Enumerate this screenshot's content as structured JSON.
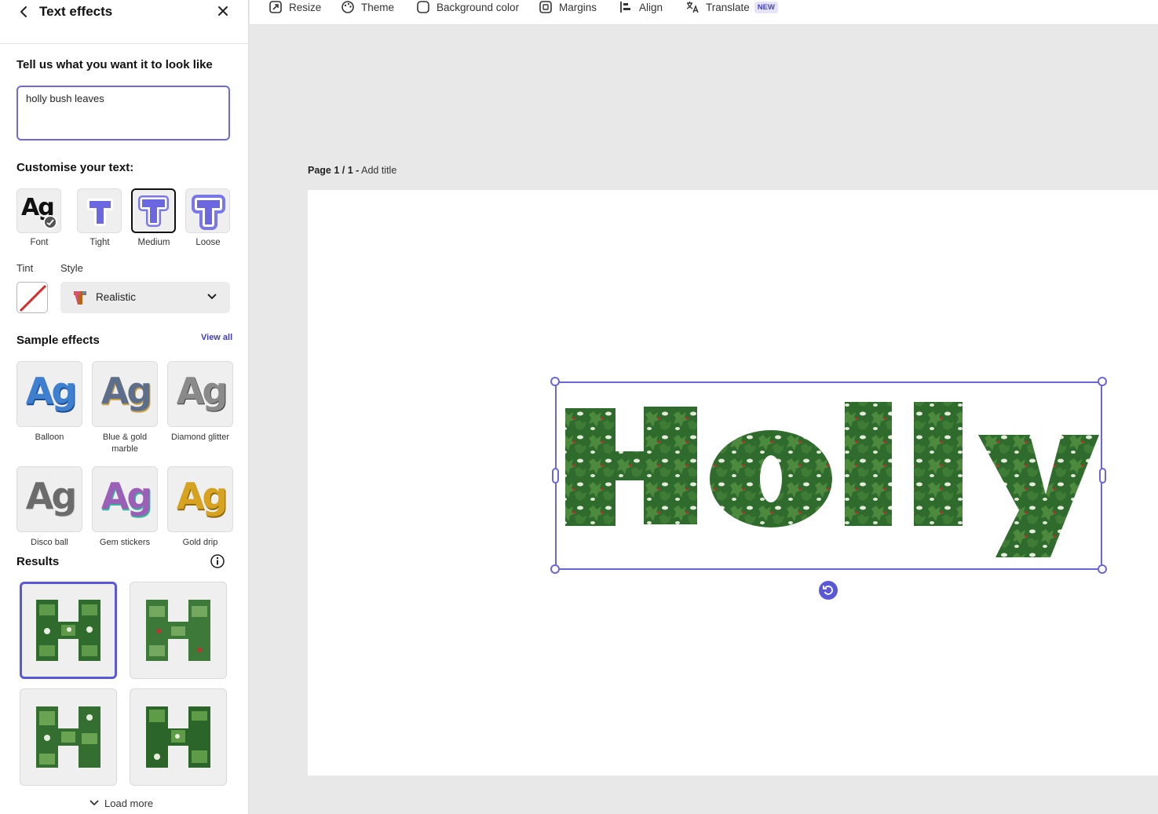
{
  "panel": {
    "title": "Text effects",
    "prompt_label": "Tell us what you want it to look like",
    "prompt_value": "holly bush leaves",
    "customise_label": "Customise your text:",
    "options": [
      {
        "label": "Font",
        "glyph": "Ag",
        "icon": "font-icon"
      },
      {
        "label": "Tight",
        "icon": "tight-outline-icon"
      },
      {
        "label": "Medium",
        "icon": "medium-outline-icon",
        "selected": true
      },
      {
        "label": "Loose",
        "icon": "loose-outline-icon"
      }
    ],
    "tint_label": "Tint",
    "style_label": "Style",
    "style_value": "Realistic",
    "sample_label": "Sample effects",
    "view_all": "View all",
    "sample_glyph": "Ag",
    "samples": [
      {
        "label": "Balloon",
        "color": "#3f7fd0"
      },
      {
        "label": "Blue & gold marble",
        "color": "#5d6e8a"
      },
      {
        "label": "Diamond glitter",
        "color": "#8a8a8a"
      },
      {
        "label": "Disco ball",
        "color": "#6b6b6b"
      },
      {
        "label": "Gem stickers",
        "color": "#9c5fb8"
      },
      {
        "label": "Gold drip",
        "color": "#d6a21f"
      }
    ],
    "results_label": "Results",
    "results_glyph": "H",
    "load_more": "Load more"
  },
  "toolbar": {
    "items": [
      {
        "label": "Resize",
        "icon": "resize-icon"
      },
      {
        "label": "Theme",
        "icon": "palette-icon"
      },
      {
        "label": "Background color",
        "icon": "background-color-icon"
      },
      {
        "label": "Margins",
        "icon": "margins-icon"
      },
      {
        "label": "Align",
        "icon": "align-icon"
      },
      {
        "label": "Translate",
        "icon": "translate-icon",
        "badge": "NEW"
      }
    ]
  },
  "canvas": {
    "page_label": "Page 1 / 1 -",
    "add_title": "Add title",
    "text": "Holly"
  },
  "colors": {
    "accent": "#5b58d8",
    "leaf": "#2f6b2c",
    "leaf_light": "#5e9a4a",
    "tint_slash": "#d52a2a"
  }
}
